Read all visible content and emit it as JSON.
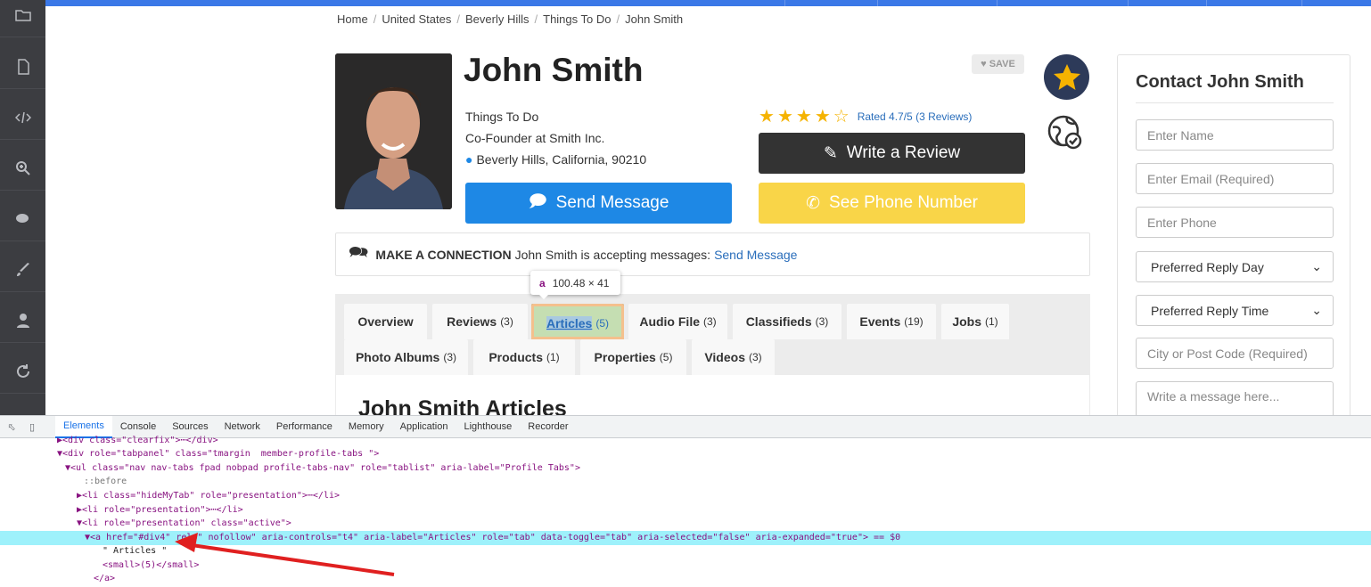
{
  "breadcrumb": [
    "Home",
    "United States",
    "Beverly Hills",
    "Things To Do",
    "John Smith"
  ],
  "profile": {
    "name": "John Smith",
    "save": "SAVE",
    "category": "Things To Do",
    "position": "Co-Founder at Smith Inc.",
    "location": "Beverly Hills, California, 90210",
    "rating_text": "Rated 4.7/5",
    "reviews_link": "(3 Reviews)",
    "rating": 4.7
  },
  "buttons": {
    "write_review": "Write a Review",
    "send_message": "Send Message",
    "see_phone": "See Phone Number"
  },
  "connection": {
    "label": "MAKE A CONNECTION",
    "text": "John Smith is accepting messages:",
    "link": "Send Message"
  },
  "tooltip": {
    "tag": "a",
    "size": "100.48 × 41"
  },
  "tabs": [
    {
      "label": "Overview",
      "count": ""
    },
    {
      "label": "Reviews",
      "count": "(3)"
    },
    {
      "label": "Articles",
      "count": "(5)"
    },
    {
      "label": "Audio File",
      "count": "(3)"
    },
    {
      "label": "Classifieds",
      "count": "(3)"
    },
    {
      "label": "Events",
      "count": "(19)"
    },
    {
      "label": "Jobs",
      "count": "(1)"
    },
    {
      "label": "Photo Albums",
      "count": "(3)"
    },
    {
      "label": "Products",
      "count": "(1)"
    },
    {
      "label": "Properties",
      "count": "(5)"
    },
    {
      "label": "Videos",
      "count": "(3)"
    }
  ],
  "articles_heading": "John Smith Articles",
  "contact": {
    "title": "Contact John Smith",
    "name": "Enter Name",
    "email": "Enter Email (Required)",
    "phone": "Enter Phone",
    "reply_day": "Preferred Reply Day",
    "reply_time": "Preferred Reply Time",
    "city": "City or Post Code (Required)",
    "message": "Write a message here..."
  },
  "devtools": {
    "tabs": [
      "Elements",
      "Console",
      "Sources",
      "Network",
      "Performance",
      "Memory",
      "Application",
      "Lighthouse",
      "Recorder"
    ],
    "lines": [
      "▶<div class=\"clearfix\">⋯</div>",
      "▼<div role=\"tabpanel\" class=\"tmargin  member-profile-tabs \">",
      "▼<ul class=\"nav nav-tabs fpad nobpad profile-tabs-nav\" role=\"tablist\" aria-label=\"Profile Tabs\">",
      "::before",
      "▶<li class=\"hideMyTab\" role=\"presentation\">⋯</li>",
      "▶<li role=\"presentation\">⋯</li>",
      "▼<li role=\"presentation\" class=\"active\">",
      "▼<a href=\"#div4\" rel=\" nofollow\" aria-controls=\"t4\" aria-label=\"Articles\" role=\"tab\" data-toggle=\"tab\" aria-selected=\"false\" aria-expanded=\"true\"> == $0",
      "\" Articles \"",
      "<small>(5)</small>",
      "</a>"
    ]
  }
}
